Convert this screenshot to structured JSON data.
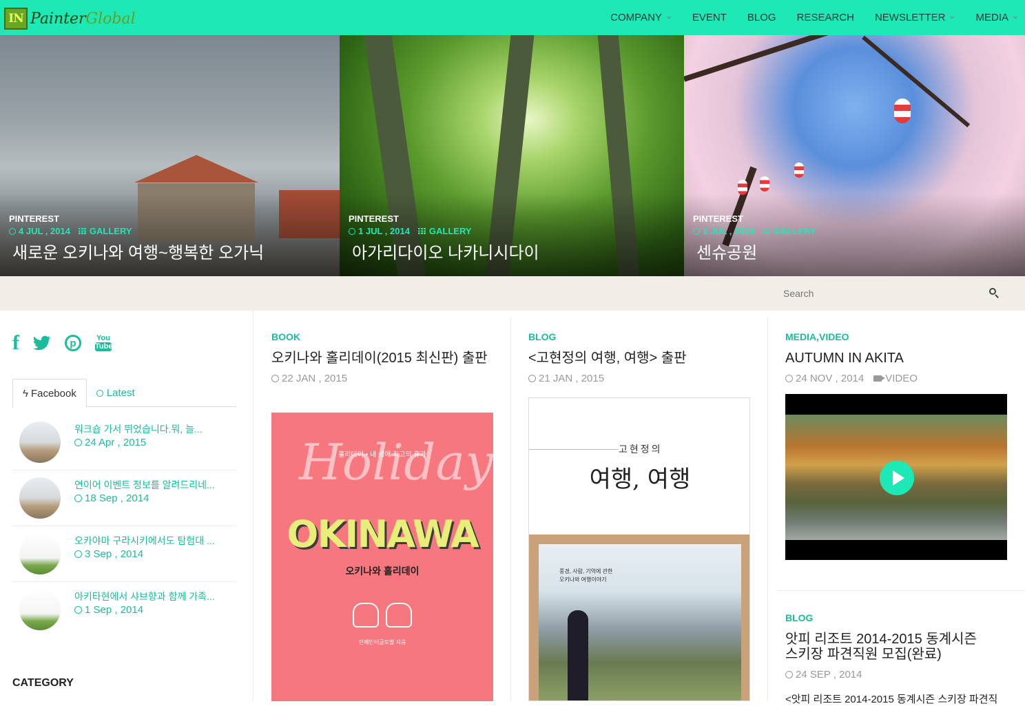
{
  "header": {
    "logo_box": "IN",
    "logo_painter": "Painter",
    "logo_global": "Global",
    "nav": [
      {
        "label": "COMPANY",
        "has_dropdown": true
      },
      {
        "label": "EVENT",
        "has_dropdown": false
      },
      {
        "label": "BLOG",
        "has_dropdown": false
      },
      {
        "label": "RESEARCH",
        "has_dropdown": false
      },
      {
        "label": "NEWSLETTER",
        "has_dropdown": true
      },
      {
        "label": "MEDIA",
        "has_dropdown": true
      }
    ]
  },
  "hero": [
    {
      "category": "PINTEREST",
      "date": "4 JUL , 2014",
      "type": "GALLERY",
      "title": "새로운 오키나와 여행~행복한 오가닉"
    },
    {
      "category": "PINTEREST",
      "date": "1 JUL , 2014",
      "type": "GALLERY",
      "title": "아가리다이오 나카니시다이"
    },
    {
      "category": "PINTEREST",
      "date": "1 JUL , 2014",
      "type": "GALLERY",
      "title": "센슈공원"
    }
  ],
  "search": {
    "placeholder": "Search"
  },
  "sidebar": {
    "social": {
      "facebook": "f",
      "pinterest": "p",
      "youtube_top": "You",
      "youtube_bottom": "Tube"
    },
    "tabs": [
      {
        "label": "Facebook",
        "active": true
      },
      {
        "label": "Latest",
        "active": false
      }
    ],
    "feed": [
      {
        "title": "워크숍 가서 뛰었습니다.뭐, 늘...",
        "date": "24 Apr , 2015",
        "thumb": "photo"
      },
      {
        "title": "연이어 이벤트 정보를 알려드리네...",
        "date": "18 Sep , 2014",
        "thumb": "photo"
      },
      {
        "title": "오카야마 구라시키에서도 탐험대 ...",
        "date": "3 Sep , 2014",
        "thumb": "paper"
      },
      {
        "title": "아키타현에서 샤브향과 함께 가족...",
        "date": "1 Sep , 2014",
        "thumb": "paper"
      }
    ],
    "category_heading": "CATEGORY"
  },
  "posts": {
    "book": {
      "category": "BOOK",
      "title": "오키나와 홀리데이(2015 최신판) 출판",
      "date": "22 JAN , 2015",
      "cover": {
        "script": "Holiday",
        "tagline": "홀리데이 • 내 생애 최고의 휴가",
        "headline": "OKINAWA",
        "subtitle": "오키나와 홀리데이",
        "author": "인페인터글로벌 지음"
      }
    },
    "blog1": {
      "category": "BLOG",
      "title": "<고현정의 여행, 여행> 출판",
      "date": "21 JAN , 2015",
      "cover": {
        "author": "고현정의",
        "title": "여행, 여행",
        "caption_line1": "풍경, 사람, 기억에 관한",
        "caption_line2": "오키나와 여행이야기"
      }
    },
    "media": {
      "category": "MEDIA,VIDEO",
      "title": "AUTUMN IN AKITA",
      "date": "24 NOV , 2014",
      "type": "VIDEO"
    },
    "blog2": {
      "category": "BLOG",
      "title_line1": "앗피 리조트 2014-2015 동계시즌",
      "title_line2": "스키장 파견직원 모집(완료)",
      "date": "24 SEP , 2014",
      "excerpt": "<앗피 리조트 2014-2015 동계시즌 스키장 파견직"
    }
  },
  "colors": {
    "accent": "#1de9b6",
    "link": "#1abc9c",
    "search_bg": "#f0eee6"
  }
}
